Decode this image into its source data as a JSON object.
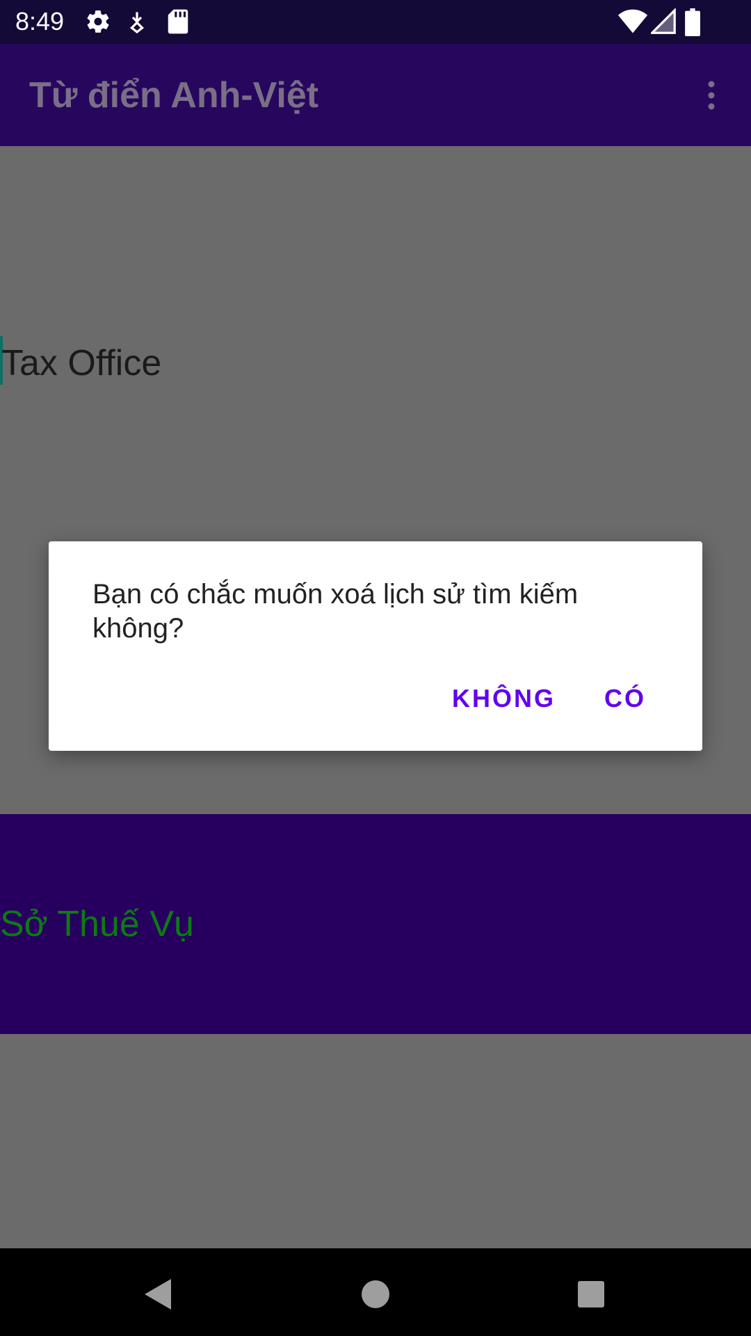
{
  "status_bar": {
    "time": "8:49",
    "left_icons": [
      "settings-icon",
      "download-icon",
      "sd-card-icon"
    ],
    "right_icons": [
      "wifi-icon",
      "signal-icon",
      "battery-icon"
    ]
  },
  "app_bar": {
    "title": "Từ điển Anh-Việt",
    "menu_icon": "overflow-menu-icon"
  },
  "content": {
    "source_text": "Tax Office",
    "translation_text": "Sở Thuế Vụ"
  },
  "dialog": {
    "message": "Bạn có chắc muốn xoá lịch sử tìm kiếm không?",
    "negative_button": "KHÔNG",
    "positive_button": "CÓ"
  },
  "nav_bar": {
    "icons": [
      "back-icon",
      "home-icon",
      "recents-icon"
    ]
  },
  "colors": {
    "status_bar": "#130a37",
    "app_bar": "#27075e",
    "result_panel": "#27005f",
    "translation_text": "#0d7a14",
    "accent": "#6200ee",
    "scrim_background": "#6b6b6b"
  }
}
